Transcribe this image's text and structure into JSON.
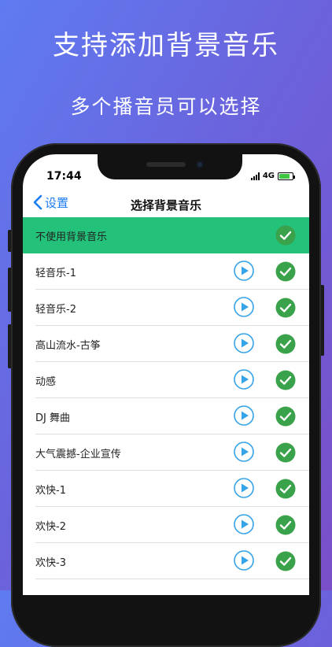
{
  "promo": {
    "title": "支持添加背景音乐",
    "subtitle": "多个播音员可以选择"
  },
  "status_bar": {
    "time": "17:44",
    "network": "4G",
    "signal_icon": "cellular-signal-icon",
    "battery_icon": "battery-charging-icon"
  },
  "nav": {
    "back_label": "设置",
    "back_icon": "chevron-left-icon",
    "title": "选择背景音乐"
  },
  "colors": {
    "accent_blue": "#1c7cf3",
    "selected_row_bg": "#23c17a",
    "check_green": "#3aa24b",
    "play_blue": "#35a3e8"
  },
  "music_list": [
    {
      "label": "不使用背景音乐",
      "selected": true,
      "has_play": false
    },
    {
      "label": "轻音乐-1",
      "selected": false,
      "has_play": true
    },
    {
      "label": "轻音乐-2",
      "selected": false,
      "has_play": true
    },
    {
      "label": "高山流水-古筝",
      "selected": false,
      "has_play": true
    },
    {
      "label": "动感",
      "selected": false,
      "has_play": true
    },
    {
      "label": "DJ 舞曲",
      "selected": false,
      "has_play": true
    },
    {
      "label": "大气震撼-企业宣传",
      "selected": false,
      "has_play": true
    },
    {
      "label": "欢快-1",
      "selected": false,
      "has_play": true
    },
    {
      "label": "欢快-2",
      "selected": false,
      "has_play": true
    },
    {
      "label": "欢快-3",
      "selected": false,
      "has_play": true
    }
  ]
}
